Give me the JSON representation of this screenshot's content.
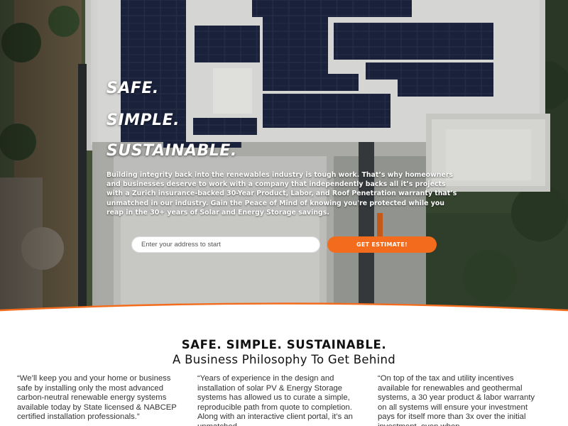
{
  "hero": {
    "headline_1": "SAFE.",
    "headline_2": "SIMPLE.",
    "headline_3": "SUSTAINABLE.",
    "paragraph": "Building integrity back into the renewables industry is tough work. That’s why homeowners and businesses deserve to work with a company that independently backs all it’s projects with a Zurich insurance-backed 30-Year Product, Labor, and Roof Penetration warranty that’s unmatched in our industry. Gain the Peace of Mind of knowing you're protected while you reap in the 30+ years of Solar and Energy Storage savings.",
    "address_placeholder": "Enter your address to start",
    "cta_label": "GET ESTIMATE!",
    "accent_color": "#f36b1c"
  },
  "philosophy": {
    "title": "SAFE. SIMPLE. SUSTAINABLE.",
    "subtitle": "A Business Philosophy To Get Behind",
    "columns": [
      {
        "text": "“We’ll keep you and your home or business safe by installing only the most advanced carbon-neutral renewable energy systems available today by State licensed & NABCEP certified installation professionals.”"
      },
      {
        "text": "“Years of experience in the design and installation of solar PV & Energy Storage systems has allowed us to curate a simple, reproducible path from quote to completion. Along with an interactive client portal, it’s an unmatched"
      },
      {
        "text": "“On top of the tax and utility incentives available for renewables and geothermal systems, a 30 year product & labor warranty on all systems will ensure your investment pays for itself more than 3x over the initial investment, even when"
      }
    ]
  }
}
